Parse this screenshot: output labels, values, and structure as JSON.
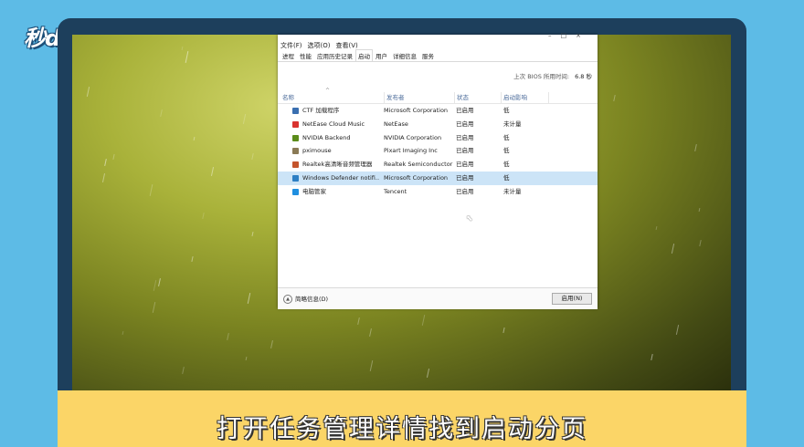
{
  "logo": "秒dong视频",
  "caption": "打开任务管理详情找到启动分页",
  "window": {
    "menu": [
      "文件(F)",
      "选项(O)",
      "查看(V)"
    ],
    "tabs": [
      "进程",
      "性能",
      "应用历史记录",
      "启动",
      "用户",
      "详细信息",
      "服务"
    ],
    "active_tab": "启动",
    "bios_label": "上次 BIOS 所用时间:",
    "bios_value": "6.8 秒",
    "columns": [
      "名称",
      "发布者",
      "状态",
      "启动影响"
    ],
    "rows": [
      {
        "name": "CTF 加载程序",
        "publisher": "Microsoft Corporation",
        "status": "已启用",
        "impact": "低",
        "icon": "pen-icon",
        "color": "#3a6fb0"
      },
      {
        "name": "NetEase Cloud Music",
        "publisher": "NetEase",
        "status": "已启用",
        "impact": "未计量",
        "icon": "netease-music-icon",
        "color": "#d9332f"
      },
      {
        "name": "NVIDIA Backend",
        "publisher": "NVIDIA Corporation",
        "status": "已启用",
        "impact": "低",
        "icon": "nvidia-icon",
        "color": "#5b8c1a"
      },
      {
        "name": "pximouse",
        "publisher": "Pixart Imaging Inc",
        "status": "已启用",
        "impact": "低",
        "icon": "mouse-icon",
        "color": "#8a7a55"
      },
      {
        "name": "Realtek高清晰音频管理器",
        "publisher": "Realtek Semiconductor",
        "status": "已启用",
        "impact": "低",
        "icon": "speaker-icon",
        "color": "#c4542c"
      },
      {
        "name": "Windows Defender notifi...",
        "publisher": "Microsoft Corporation",
        "status": "已启用",
        "impact": "低",
        "icon": "defender-shield-icon",
        "color": "#2d7fc4"
      },
      {
        "name": "电脑管家",
        "publisher": "Tencent",
        "status": "已启用",
        "impact": "未计量",
        "icon": "pc-manager-icon",
        "color": "#1f8fe0"
      }
    ],
    "selected_row": 5,
    "fewer_details": "简略信息(D)",
    "enable_button": "启用(N)"
  }
}
